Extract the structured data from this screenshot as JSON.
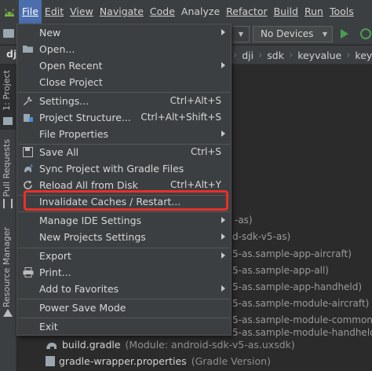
{
  "menubar": {
    "items": [
      {
        "label": "File",
        "active": true
      },
      {
        "label": "Edit"
      },
      {
        "label": "View"
      },
      {
        "label": "Navigate"
      },
      {
        "label": "Code"
      },
      {
        "label": "Analyze"
      },
      {
        "label": "Refactor"
      },
      {
        "label": "Build"
      },
      {
        "label": "Run"
      },
      {
        "label": "Tools"
      }
    ]
  },
  "toolbar": {
    "device_selector": "No Devices"
  },
  "breadcrumb": {
    "root": "dji",
    "items": [
      "dji",
      "sdk",
      "keyvalue",
      "key"
    ]
  },
  "stripe": {
    "project_tab": "1: Project",
    "pull_requests_tab": "Pull Requests",
    "resource_manager_tab": "Resource Manager"
  },
  "tree": {
    "fragments": [
      "-as)",
      "d-sdk-v5-as)",
      "5-as.sample-app-aircraft)",
      "5-as.sample-app-all)",
      "5-as.sample-app-handheld)",
      "5-as.sample-module-aircraft)",
      "5-as.sample-module-common)",
      "5-as.sample-module-handheld)"
    ],
    "rows": [
      {
        "name": "build.gradle",
        "module": "(Module: android-sdk-v5-as.uxsdk)"
      },
      {
        "name": "gradle-wrapper.properties",
        "module": "(Gradle Version)"
      }
    ]
  },
  "file_menu": {
    "items": [
      {
        "label": "New",
        "submenu": true
      },
      {
        "label": "Open..."
      },
      {
        "label": "Open Recent",
        "submenu": true
      },
      {
        "label": "Close Project"
      },
      {
        "label": "Settings...",
        "shortcut": "Ctrl+Alt+S"
      },
      {
        "label": "Project Structure...",
        "shortcut": "Ctrl+Alt+Shift+S"
      },
      {
        "label": "File Properties",
        "submenu": true
      },
      {
        "label": "Save All",
        "shortcut": "Ctrl+S"
      },
      {
        "label": "Sync Project with Gradle Files"
      },
      {
        "label": "Reload All from Disk",
        "shortcut": "Ctrl+Alt+Y"
      },
      {
        "label": "Invalidate Caches / Restart..."
      },
      {
        "label": "Manage IDE Settings",
        "submenu": true
      },
      {
        "label": "New Projects Settings",
        "submenu": true
      },
      {
        "label": "Export",
        "submenu": true
      },
      {
        "label": "Print..."
      },
      {
        "label": "Add to Favorites",
        "submenu": true
      },
      {
        "label": "Power Save Mode"
      },
      {
        "label": "Exit"
      }
    ]
  },
  "colors": {
    "highlight_border": "#e8302a",
    "active_menu": "#4b6eaf",
    "run_green": "#499c54"
  }
}
